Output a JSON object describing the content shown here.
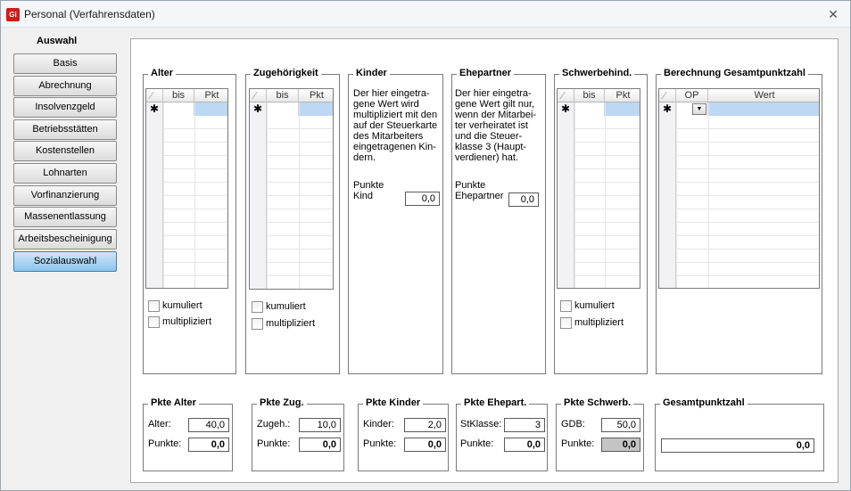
{
  "window": {
    "title": "Personal (Verfahrensdaten)",
    "app_icon_text": "Gi"
  },
  "nav": {
    "heading": "Auswahl",
    "items": [
      {
        "label": "Basis"
      },
      {
        "label": "Abrechnung"
      },
      {
        "label": "Insolvenzgeld"
      },
      {
        "label": "Betriebsstätten"
      },
      {
        "label": "Kostenstellen"
      },
      {
        "label": "Lohnarten"
      },
      {
        "label": "Vorfinanzierung"
      },
      {
        "label": "Massenentlassung"
      },
      {
        "label": "Arbeitsbescheinigung"
      },
      {
        "label": "Sozialauswahl",
        "active": true
      }
    ]
  },
  "groups": {
    "alter": {
      "title": "Alter",
      "col1": "bis",
      "col2": "Pkt",
      "kumuliert": "kumuliert",
      "multipliziert": "multipliziert"
    },
    "zugehoerigkeit": {
      "title": "Zugehörigkeit",
      "col1": "bis",
      "col2": "Pkt",
      "kumuliert": "kumuliert",
      "multipliziert": "multipliziert"
    },
    "kinder": {
      "title": "Kinder",
      "note": "Der hier eingetra-\ngene Wert wird\nmultipliziert mit den\nauf der Steuerkarte\ndes Mitarbeiters\neingetragenen Kin-\ndern.",
      "label": "Punkte\nKind",
      "value": "0,0"
    },
    "ehepartner": {
      "title": "Ehepartner",
      "note": "Der hier eingetra-\ngene Wert gilt nur,\nwenn der Mitarbei-\nter verheiratet ist\nund die Steuer-\nklasse 3 (Haupt-\nverdiener) hat.",
      "label": "Punkte\nEhepartner",
      "value": "0,0"
    },
    "schwerbehind": {
      "title": "Schwerbehind.",
      "col1": "bis",
      "col2": "Pkt",
      "kumuliert": "kumuliert",
      "multipliziert": "multipliziert"
    },
    "berechnung": {
      "title": "Berechnung Gesamtpunktzahl",
      "col1": "OP",
      "col2": "Wert"
    }
  },
  "pkte": {
    "alter": {
      "title": "Pkte Alter",
      "label1": "Alter:",
      "value1": "40,0",
      "label2": "Punkte:",
      "value2": "0,0"
    },
    "zug": {
      "title": "Pkte Zug.",
      "label1": "Zugeh.:",
      "value1": "10,0",
      "label2": "Punkte:",
      "value2": "0,0"
    },
    "kinder": {
      "title": "Pkte Kinder",
      "label1": "Kinder:",
      "value1": "2,0",
      "label2": "Punkte:",
      "value2": "0,0"
    },
    "ehepart": {
      "title": "Pkte Ehepart.",
      "label1": "StKlasse:",
      "value1": "3",
      "label2": "Punkte:",
      "value2": "0,0"
    },
    "schwerb": {
      "title": "Pkte Schwerb.",
      "label1": "GDB:",
      "value1": "50,0",
      "label2": "Punkte:",
      "value2": "0,0"
    },
    "gesamt": {
      "title": "Gesamtpunktzahl",
      "value": "0,0"
    }
  },
  "icons": {
    "close": "close-icon",
    "new_row": "asterisk-icon",
    "dropdown": "dropdown-arrow-icon"
  }
}
